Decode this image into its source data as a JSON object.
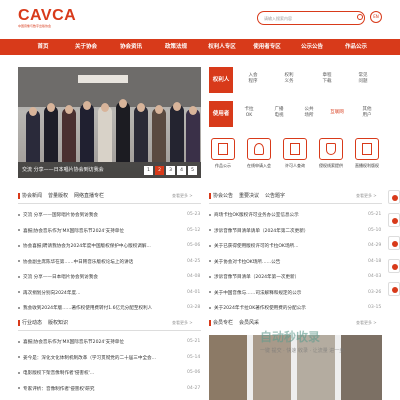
{
  "header": {
    "logo_text": "CAVCA",
    "logo_subtitle": "中国音像与数字出版协会",
    "search_placeholder": "请输入搜索内容",
    "lang_label": "EN"
  },
  "nav": {
    "items": [
      "首页",
      "关于协会",
      "协会资讯",
      "政策法规",
      "权利人专区",
      "使用者专区",
      "公示公告",
      "作品公示"
    ],
    "active_index": 0
  },
  "banner": {
    "caption": "交流 分享——日本唱片协会到访我会",
    "pages": [
      "1",
      "2",
      "3",
      "4",
      "5"
    ],
    "active_page": 1
  },
  "rights_holder": {
    "label": "权利人",
    "items": [
      "入会\n程序",
      "权利\n义务",
      "章程\n下载",
      "常见\n问题"
    ]
  },
  "users": {
    "label": "使用者",
    "items": [
      "卡拉\nOK",
      "广播\n电视",
      "公共\n场所",
      "互联网",
      "其他\n用户"
    ]
  },
  "services": [
    {
      "label": "作品公示",
      "icon": "document-icon"
    },
    {
      "label": "在线申请入会",
      "icon": "person-icon"
    },
    {
      "label": "许可人查询",
      "icon": "search-doc-icon"
    },
    {
      "label": "侵权线索提供",
      "icon": "shield-icon"
    },
    {
      "label": "直播权利版权",
      "icon": "broadcast-icon"
    }
  ],
  "news": {
    "tabs": [
      "协会新闻",
      "曾量版权",
      "网络直播专栏"
    ],
    "more": "查看更多 >",
    "items": [
      {
        "title": "交流 分享——国际唱片协会到访我会",
        "date": "05-23"
      },
      {
        "title": "喜报|协会音乐作为'MX国际音乐节2024'支持单位",
        "date": "05-12"
      },
      {
        "title": "协会喜报|聘请我协会为2024年度中国版权保护中心版权调解...",
        "date": "05-06"
      },
      {
        "title": "协会副主席陈华在第……中日韩音乐版权论坛上的讲话",
        "date": "04-25"
      },
      {
        "title": "交流 分享——日本唱片协会到访我会",
        "date": "04-08"
      },
      {
        "title": "再次捐划分别向2024年度...",
        "date": "04-01"
      },
      {
        "title": "我会收到2024年版……著作权使用费转付1.6亿元分配至权利人",
        "date": "03-28"
      }
    ]
  },
  "notices": {
    "tabs": [
      "协会公告",
      "重要决议",
      "公告题字"
    ],
    "more": "查看更多 >",
    "items": [
      {
        "title": "商场卡拉OK版权许可业务办公室信息公示",
        "date": "05-21"
      },
      {
        "title": "涉诉音像节目清单请单（2024年第二次更新）",
        "date": "05-10"
      },
      {
        "title": "关于已获得使用版权许可的卡拉OK场所...",
        "date": "04-29"
      },
      {
        "title": "关于协会对卡拉OK场所……公告",
        "date": "04-18"
      },
      {
        "title": "涉诉音像节目清单（2024年第一次更新）",
        "date": "04-03"
      },
      {
        "title": "关于中国音像与……司法解释和规定的公示",
        "date": "03-26"
      },
      {
        "title": "关于2024年卡拉OK著作权使用费的分配公示",
        "date": "03-15"
      }
    ]
  },
  "industry": {
    "tabs": [
      "行业动态",
      "版权知识"
    ],
    "more": "查看更多 >",
    "items": [
      {
        "title": "喜报|协会音乐作为'MX国际音乐节2024'支持单位",
        "date": "05-21"
      },
      {
        "title": "姜今是：深化文化体制机制改革（学习贯彻党的二十届三中全会...",
        "date": "05-14"
      },
      {
        "title": "电影版权下架音像制作者'侵害权'...",
        "date": "05-06"
      },
      {
        "title": "专家评析：音像制作者'侵害权'研究",
        "date": "04-27"
      }
    ]
  },
  "features": {
    "tabs": [
      "会员专栏",
      "会员风采"
    ],
    "more": "查看更多 >"
  },
  "watermark": {
    "main": "自动秒收录",
    "sub": "一键 提交 · 快速 收录 · 让流量 进一步"
  },
  "colors": {
    "brand": "#d83a1a",
    "nav_text": "#ffffff"
  }
}
